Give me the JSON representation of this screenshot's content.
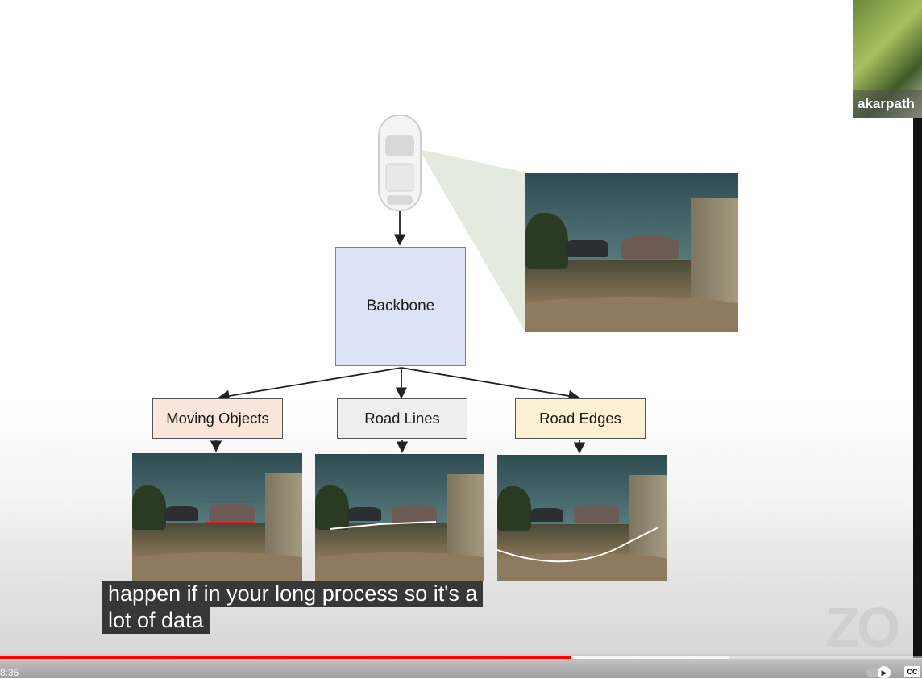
{
  "diagram": {
    "backbone_label": "Backbone",
    "heads": [
      {
        "label": "Moving Objects",
        "color": "#fbe6dc"
      },
      {
        "label": "Road Lines",
        "color": "#eeeeee"
      },
      {
        "label": "Road Edges",
        "color": "#fdf0d5"
      }
    ]
  },
  "participant": {
    "name": "akarpath"
  },
  "watermark": "ZO",
  "captions": [
    "happen if in your long process so it's a",
    "lot of data"
  ],
  "player": {
    "elapsed": "8:35",
    "progress_fraction": 0.62,
    "buffered_fraction": 0.79,
    "accent": "#ff0000",
    "cc_label": "CC"
  }
}
